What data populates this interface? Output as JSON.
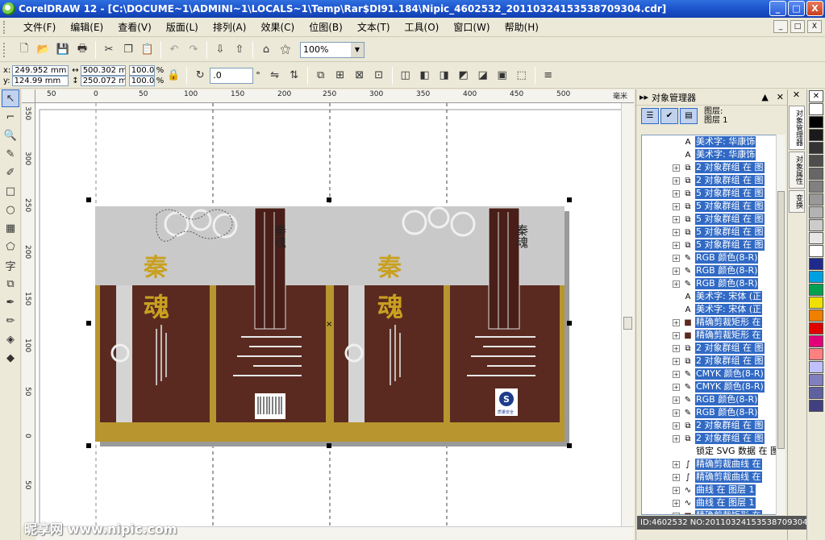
{
  "window": {
    "title": "CorelDRAW 12 - [C:\\DOCUME~1\\ADMINI~1\\LOCALS~1\\Temp\\Rar$DI91.184\\Nipic_4602532_20110324153538709304.cdr]",
    "minimize_label": "_",
    "maximize_label": "□",
    "close_label": "X"
  },
  "menu": [
    "文件(F)",
    "编辑(E)",
    "查看(V)",
    "版面(L)",
    "排列(A)",
    "效果(C)",
    "位图(B)",
    "文本(T)",
    "工具(O)",
    "窗口(W)",
    "帮助(H)"
  ],
  "mdi_buttons": [
    "_",
    "□",
    "X"
  ],
  "standard_toolbar": {
    "zoom_value": "100%",
    "icons": [
      "new-icon",
      "open-icon",
      "save-icon",
      "print-icon",
      "cut-icon",
      "copy-icon",
      "paste-icon",
      "undo-icon",
      "redo-icon",
      "import-icon",
      "export-icon",
      "launcher-icon",
      "corel-online-icon"
    ]
  },
  "property_bar": {
    "x": "249.952 mm",
    "y": "124.99 mm",
    "width": "500.302 mm",
    "height": "250.072 mm",
    "scale_x": "100.0",
    "scale_y": "100.0",
    "percent": "%",
    "rotation": ".0",
    "degree": "°"
  },
  "toolbox": [
    "pick-tool",
    "shape-tool",
    "zoom-tool",
    "freehand-tool",
    "smart-fill-tool",
    "rectangle-tool",
    "ellipse-tool",
    "polygon-tool",
    "basic-shapes-tool",
    "text-tool",
    "interactive-blend-tool",
    "eyedropper-tool",
    "outline-tool",
    "fill-tool",
    "interactive-fill-tool"
  ],
  "rulers": {
    "unit": "毫米",
    "horizontal_ticks": [
      "50",
      "0",
      "50",
      "100",
      "150",
      "200",
      "250",
      "300",
      "350",
      "400",
      "450",
      "500"
    ],
    "vertical_ticks": [
      "350",
      "300",
      "250",
      "200",
      "150",
      "100",
      "50",
      "0",
      "50"
    ]
  },
  "artwork": {
    "brand_vertical": "秦魂",
    "brand_large_1": "秦",
    "brand_large_2": "魂",
    "qs_mark": "S",
    "qs_caption": "质量安全"
  },
  "object_manager": {
    "title": "对象管理器",
    "layer_line1": "图层:",
    "layer_line2": "图层 1",
    "rows": [
      {
        "icon": "artistic-text-icon",
        "label": "美术字: 华康饰"
      },
      {
        "icon": "artistic-text-icon",
        "label": "美术字: 华康饰"
      },
      {
        "icon": "group-icon",
        "label": "2 对象群组 在 图"
      },
      {
        "icon": "group-icon",
        "label": "2 对象群组 在 图"
      },
      {
        "icon": "group-icon",
        "label": "5 对象群组 在 图"
      },
      {
        "icon": "group-icon",
        "label": "5 对象群组 在 图"
      },
      {
        "icon": "group-icon",
        "label": "5 对象群组 在 图"
      },
      {
        "icon": "group-icon",
        "label": "5 对象群组 在 图"
      },
      {
        "icon": "group-icon",
        "label": "5 对象群组 在 图"
      },
      {
        "icon": "bitmap-icon",
        "label": "RGB 颜色(8-R)"
      },
      {
        "icon": "bitmap-icon",
        "label": "RGB 颜色(8-R)"
      },
      {
        "icon": "bitmap-icon",
        "label": "RGB 颜色(8-R)"
      },
      {
        "icon": "artistic-text-icon",
        "label": "美术字: 宋体 (正"
      },
      {
        "icon": "artistic-text-icon",
        "label": "美术字: 宋体 (正"
      },
      {
        "icon": "powerclip-rect-icon",
        "label": "精确剪裁矩形 在"
      },
      {
        "icon": "powerclip-rect-icon",
        "label": "精确剪裁矩形 在"
      },
      {
        "icon": "group-icon",
        "label": "2 对象群组 在 图"
      },
      {
        "icon": "group-icon",
        "label": "2 对象群组 在 图"
      },
      {
        "icon": "bitmap-icon",
        "label": "CMYK 颜色(8-R)"
      },
      {
        "icon": "bitmap-icon",
        "label": "CMYK 颜色(8-R)"
      },
      {
        "icon": "bitmap-icon",
        "label": "RGB 颜色(8-R)"
      },
      {
        "icon": "bitmap-icon",
        "label": "RGB 颜色(8-R)"
      },
      {
        "icon": "group-icon",
        "label": "2 对象群组 在 图"
      },
      {
        "icon": "group-icon",
        "label": "2 对象群组 在 图"
      },
      {
        "icon": "svg-icon",
        "label": "锁定 SVG 数据 在 图"
      },
      {
        "icon": "powerclip-curve-icon",
        "label": "精确剪裁曲线 在"
      },
      {
        "icon": "powerclip-curve-icon",
        "label": "精确剪裁曲线 在"
      },
      {
        "icon": "curve-icon",
        "label": "曲线 在 图层 1"
      },
      {
        "icon": "curve-icon",
        "label": "曲线 在 图层 1"
      },
      {
        "icon": "powerclip-rect-icon",
        "label": "精确剪裁矩形 在"
      }
    ]
  },
  "docker_tabs": [
    "对象管理器",
    "对象属性",
    "变换"
  ],
  "palette_colors": [
    "#ffffff",
    "#000000",
    "#1a1a1a",
    "#333333",
    "#4d4d4d",
    "#666666",
    "#808080",
    "#999999",
    "#b3b3b3",
    "#cccccc",
    "#e6e6e6",
    "#ffffff",
    "#1e2a8c",
    "#00a0e0",
    "#00a050",
    "#f0e000",
    "#f08000",
    "#e00000",
    "#e0007a",
    "#ff8080",
    "#c0c0ff",
    "#8080c0",
    "#6060a0",
    "#404080"
  ],
  "status_text": "ID:4602532 NO:20110324153538709304",
  "watermark": "昵享网 www.nipic.com"
}
